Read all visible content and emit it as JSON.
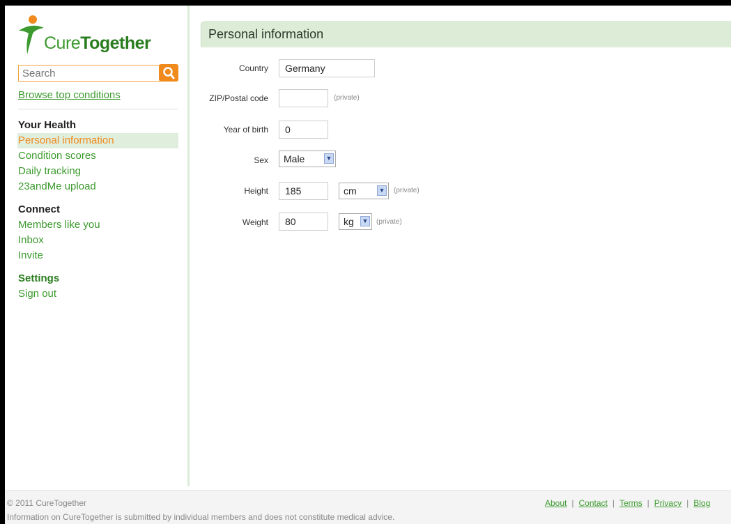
{
  "logo": {
    "part1": "Cure",
    "part2": "Together"
  },
  "sidebar": {
    "search_placeholder": "Search",
    "browse_link": "Browse top conditions",
    "sections": [
      {
        "heading": "Your Health",
        "items": [
          "Personal information",
          "Condition scores",
          "Daily tracking",
          "23andMe upload"
        ]
      },
      {
        "heading": "Connect",
        "items": [
          "Members like you",
          "Inbox",
          "Invite"
        ]
      },
      {
        "heading": "Settings",
        "items": [
          "Sign out"
        ]
      }
    ],
    "active_item": "Personal information"
  },
  "main": {
    "title": "Personal information",
    "fields": {
      "country": {
        "label": "Country",
        "value": "Germany"
      },
      "zip": {
        "label": "ZIP/Postal code",
        "value": "",
        "note": "(private)"
      },
      "year": {
        "label": "Year of birth",
        "value": "0"
      },
      "sex": {
        "label": "Sex",
        "value": "Male"
      },
      "height": {
        "label": "Height",
        "value": "185",
        "unit": "cm",
        "note": "(private)"
      },
      "weight": {
        "label": "Weight",
        "value": "80",
        "unit": "kg",
        "note": "(private)"
      }
    }
  },
  "footer": {
    "copyright": "© 2011 CureTogether",
    "disclaimer": "Information on CureTogether is submitted by individual members and does not constitute medical advice.",
    "links": [
      "About",
      "Contact",
      "Terms",
      "Privacy",
      "Blog"
    ]
  },
  "colors": {
    "brand_green": "#3c9a2e",
    "accent_orange": "#f08a1c",
    "header_green": "#dcecd6"
  }
}
